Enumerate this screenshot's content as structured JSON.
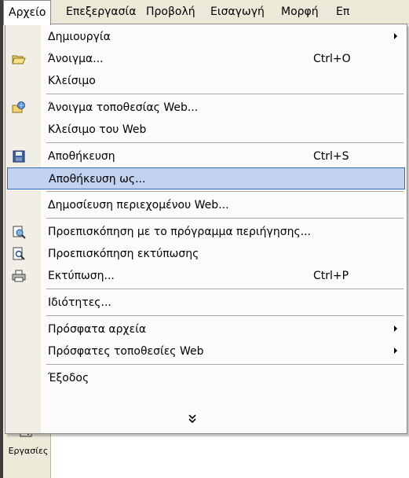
{
  "menubar": {
    "items": [
      {
        "label": "Αρχείο"
      },
      {
        "label": "Επεξεργασία"
      },
      {
        "label": "Προβολή"
      },
      {
        "label": "Εισαγωγή"
      },
      {
        "label": "Μορφή"
      },
      {
        "label": "Επ"
      }
    ]
  },
  "file_menu": {
    "items": [
      {
        "label": "Δημιουργία",
        "shortcut": "",
        "icon": "",
        "submenu": true
      },
      {
        "label": "Άνοιγμα...",
        "shortcut": "Ctrl+O",
        "icon": "open-folder-icon",
        "submenu": false
      },
      {
        "label": "Κλείσιμο",
        "shortcut": "",
        "icon": "",
        "submenu": false
      },
      {
        "label": "Άνοιγμα τοποθεσίας Web...",
        "shortcut": "",
        "icon": "web-open-icon",
        "submenu": false
      },
      {
        "label": "Κλείσιμο του Web",
        "shortcut": "",
        "icon": "",
        "submenu": false
      },
      {
        "label": "Αποθήκευση",
        "shortcut": "Ctrl+S",
        "icon": "floppy-disk-icon",
        "submenu": false
      },
      {
        "label": "Αποθήκευση ως...",
        "shortcut": "",
        "icon": "",
        "submenu": false
      },
      {
        "label": "Δημοσίευση περιεχομένου Web...",
        "shortcut": "",
        "icon": "",
        "submenu": false
      },
      {
        "label": "Προεπισκόπηση με το πρόγραμμα περιήγησης...",
        "shortcut": "",
        "icon": "web-preview-icon",
        "submenu": false
      },
      {
        "label": "Προεπισκόπηση εκτύπωσης",
        "shortcut": "",
        "icon": "print-preview-icon",
        "submenu": false
      },
      {
        "label": "Εκτύπωση...",
        "shortcut": "Ctrl+P",
        "icon": "printer-icon",
        "submenu": false
      },
      {
        "label": "Ιδιότητες...",
        "shortcut": "",
        "icon": "",
        "submenu": false
      },
      {
        "label": "Πρόσφατα αρχεία",
        "shortcut": "",
        "icon": "",
        "submenu": true
      },
      {
        "label": "Πρόσφατες τοποθεσίες Web",
        "shortcut": "",
        "icon": "",
        "submenu": true
      },
      {
        "label": "Έξοδος",
        "shortcut": "",
        "icon": "",
        "submenu": false
      }
    ],
    "highlighted": "Αποθήκευση ως..."
  },
  "task_pane": {
    "label": "Εργασίες",
    "fragment": "Y"
  },
  "colors": {
    "highlight_bg": "#c1d2ee",
    "highlight_border": "#316ac5",
    "menubar_bg": "#ece9d8"
  }
}
